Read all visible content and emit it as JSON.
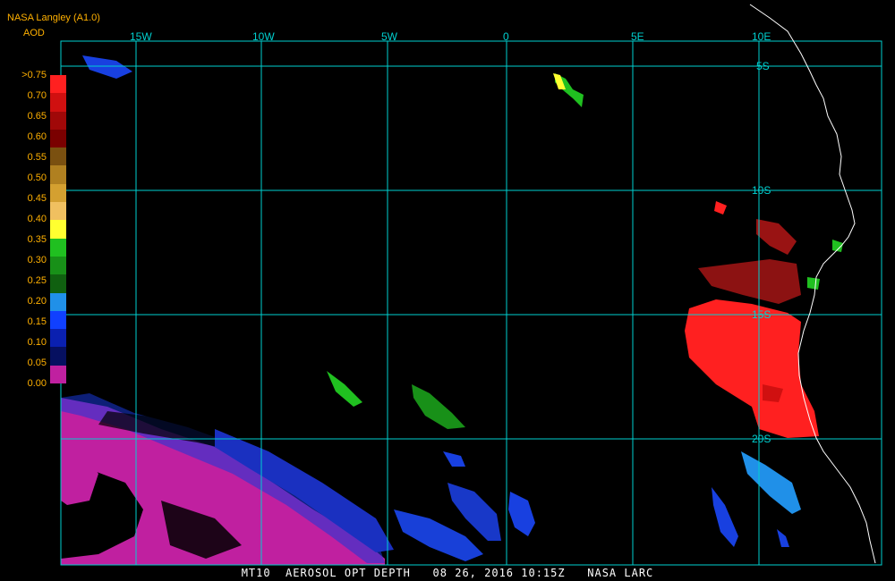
{
  "header": {
    "provider": "NASA Langley (A1.0)",
    "product": "AOD"
  },
  "legend": {
    "labels": [
      ">0.75",
      "0.70",
      "0.65",
      "0.60",
      "0.55",
      "0.50",
      "0.45",
      "0.40",
      "0.35",
      "0.30",
      "0.25",
      "0.20",
      "0.15",
      "0.10",
      "0.05",
      "0.00"
    ],
    "colors": [
      "#ff2020",
      "#d01010",
      "#a00808",
      "#7a0000",
      "#7a5010",
      "#b08020",
      "#d4a030",
      "#f0c060",
      "#ffff30",
      "#20c020",
      "#189018",
      "#106010",
      "#2090e8",
      "#1040ff",
      "#0a20b0",
      "#061060",
      "#c020a0"
    ]
  },
  "grid": {
    "longitude_labels": [
      "15W",
      "10W",
      "5W",
      "0",
      "5E",
      "10E"
    ],
    "latitude_labels": [
      "5S",
      "10S",
      "15S",
      "20S"
    ]
  },
  "footer": {
    "caption": "MT10  AEROSOL OPT DEPTH   08 26, 2016 10:15Z   NASA LARC"
  },
  "colors": {
    "grid": "#00d0d0",
    "coast": "#ffffff",
    "label": "#ffb000",
    "smoke": "#ff2020",
    "low_aod": "#c020a0"
  }
}
